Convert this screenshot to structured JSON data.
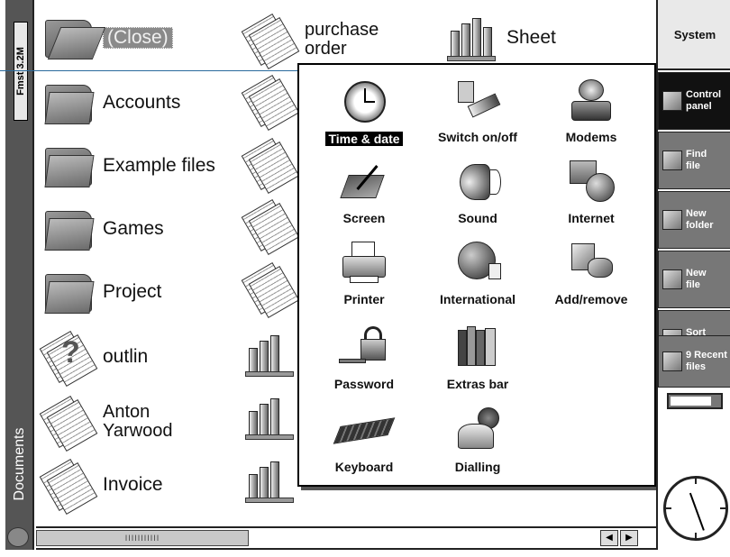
{
  "left_strip": {
    "disk_label": "Fmst 3.2M",
    "folder_label": "Documents"
  },
  "files": [
    {
      "label": "(Close)",
      "icon": "folder-open-icon"
    },
    {
      "label": "Accounts",
      "icon": "folder-icon"
    },
    {
      "label": "Example files",
      "icon": "folder-icon"
    },
    {
      "label": "Games",
      "icon": "folder-icon"
    },
    {
      "label": "Project",
      "icon": "folder-icon"
    },
    {
      "label": "outlin",
      "icon": "outline-doc-icon"
    },
    {
      "label": "Anton\nYarwood",
      "icon": "word-doc-icon"
    },
    {
      "label": "Invoice",
      "icon": "word-doc-icon"
    },
    {
      "label": "purchase\norder",
      "icon": "word-doc-icon"
    },
    {
      "label": "Sheet",
      "icon": "sheet-icon"
    }
  ],
  "control_panel": {
    "items": [
      {
        "label": "Time & date",
        "icon": "clock-icon"
      },
      {
        "label": "Switch on/off",
        "icon": "power-switch-icon"
      },
      {
        "label": "Modems",
        "icon": "modem-icon"
      },
      {
        "label": "Screen",
        "icon": "screen-icon"
      },
      {
        "label": "Sound",
        "icon": "speaker-icon"
      },
      {
        "label": "Internet",
        "icon": "globe-computer-icon"
      },
      {
        "label": "Printer",
        "icon": "printer-icon"
      },
      {
        "label": "International",
        "icon": "globe-icon"
      },
      {
        "label": "Add/remove",
        "icon": "add-remove-icon"
      },
      {
        "label": "Password",
        "icon": "key-lock-icon"
      },
      {
        "label": "Extras bar",
        "icon": "books-icon"
      },
      {
        "label": "Keyboard",
        "icon": "keyboard-icon"
      },
      {
        "label": "Dialling",
        "icon": "telephone-icon"
      }
    ]
  },
  "sidebar": {
    "title": "System",
    "buttons": [
      {
        "label": "Control\npanel",
        "icon": "control-panel-icon"
      },
      {
        "label": "Find\nfile",
        "icon": "find-file-icon"
      },
      {
        "label": "New\nfolder",
        "icon": "new-folder-icon"
      },
      {
        "label": "New\nfile",
        "icon": "new-file-icon"
      },
      {
        "label": "Sort\nby",
        "icon": "sort-icon"
      },
      {
        "label": "9 Recent\nfiles",
        "icon": "recent-files-icon"
      }
    ],
    "battery_level": 0.85
  },
  "scrollbar": {
    "thumb_text": "IIIIIIIIIII",
    "left_arrow": "◀",
    "right_arrow": "▶"
  }
}
